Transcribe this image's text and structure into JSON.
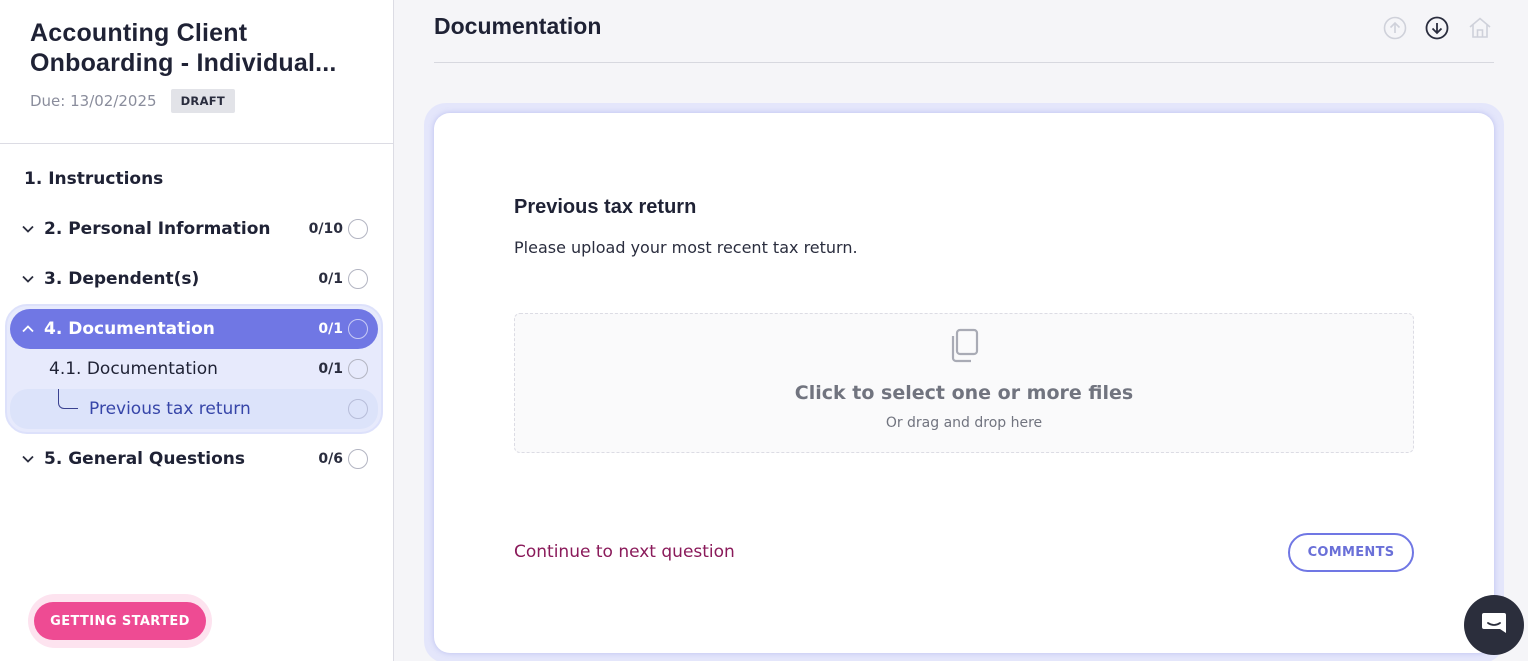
{
  "form": {
    "title_line1": "Accounting Client",
    "title_line2": "Onboarding - Individual...",
    "due": "Due: 13/02/2025",
    "status": "DRAFT"
  },
  "sidebar": {
    "items": [
      {
        "label": "1. Instructions"
      },
      {
        "label": "2. Personal Information",
        "count": "0/10"
      },
      {
        "label": "3. Dependent(s)",
        "count": "0/1"
      },
      {
        "label": "4. Documentation",
        "count": "0/1"
      },
      {
        "label": "4.1. Documentation",
        "count": "0/1"
      },
      {
        "label": "Previous tax return"
      },
      {
        "label": "5. General Questions",
        "count": "0/6"
      }
    ],
    "getting_started": "GETTING STARTED"
  },
  "main": {
    "title": "Documentation",
    "question": {
      "title": "Previous tax return",
      "description": "Please upload your most recent tax return.",
      "dropzone_main": "Click to select one or more files",
      "dropzone_sub": "Or drag and drop here"
    },
    "continue_label": "Continue to next question",
    "comments_label": "COMMENTS"
  },
  "colors": {
    "accent": "#7077e4",
    "pink": "#ee4b93",
    "link": "#8a1a5a"
  }
}
